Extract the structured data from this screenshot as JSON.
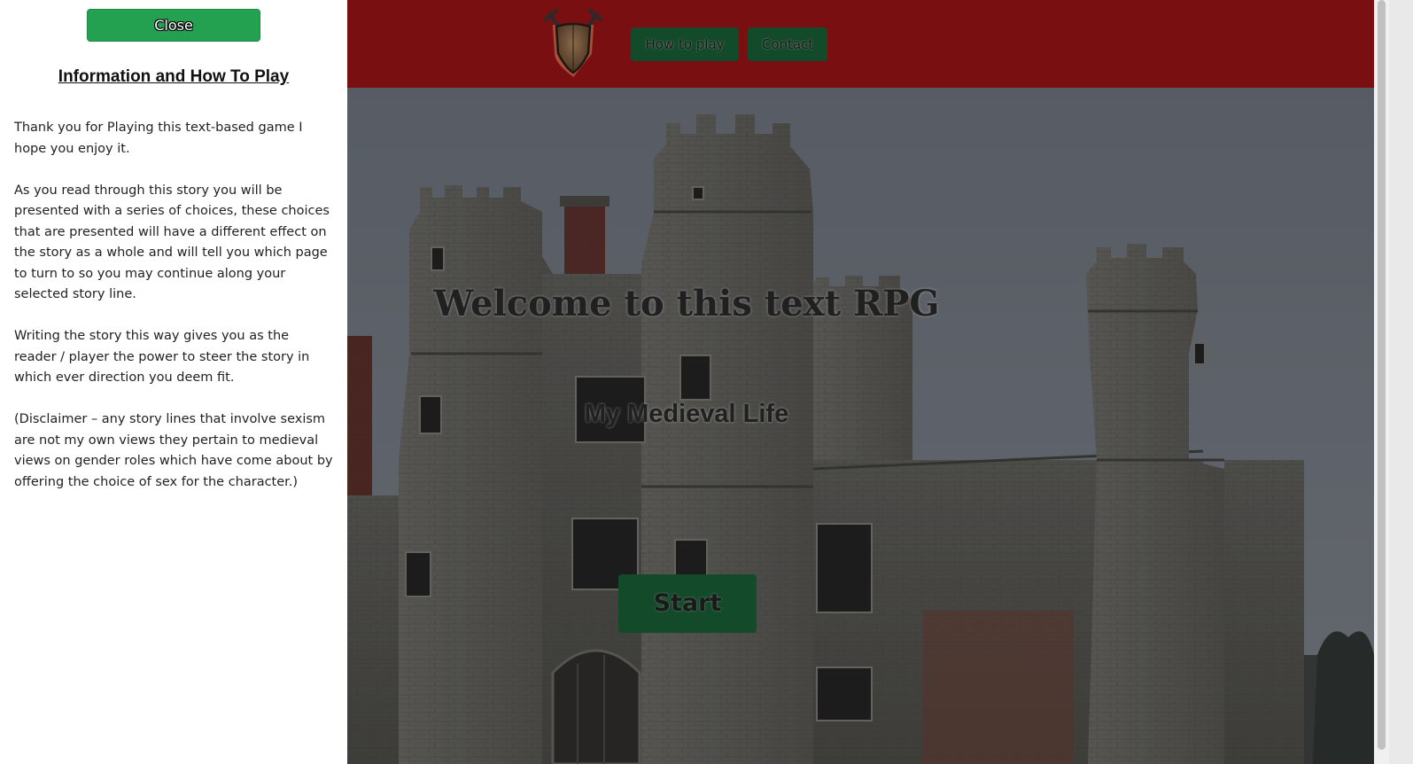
{
  "sidebar": {
    "close_label": "Close",
    "title": "Information and How To Play",
    "paragraphs": [
      "Thank you for Playing this text-based game I hope you enjoy it.",
      "As you read through this story you will be presented with a series of choices, these choices that are presented will have a different effect on the story as a whole and will tell you which page to turn to so you may continue along your selected story line.",
      "Writing the story this way gives you as the reader / player the power to steer the story in which ever direction you deem fit.",
      "(Disclaimer – any story lines that involve sexism are not my own views they pertain to medieval views on gender roles which have come about by offering the choice of sex for the character.)"
    ]
  },
  "header": {
    "logo_icon": "shield-swords-icon",
    "nav": {
      "how_to_play": "How to play",
      "contact": "Contact"
    }
  },
  "hero": {
    "title": "Welcome to this text RPG",
    "subtitle": "My Medieval Life",
    "start_label": "Start"
  },
  "colors": {
    "header_bg": "#7a0f12",
    "nav_button_bg": "#124a2a",
    "close_button_bg": "#23a050",
    "sidebar_bg": "#ffffff"
  }
}
